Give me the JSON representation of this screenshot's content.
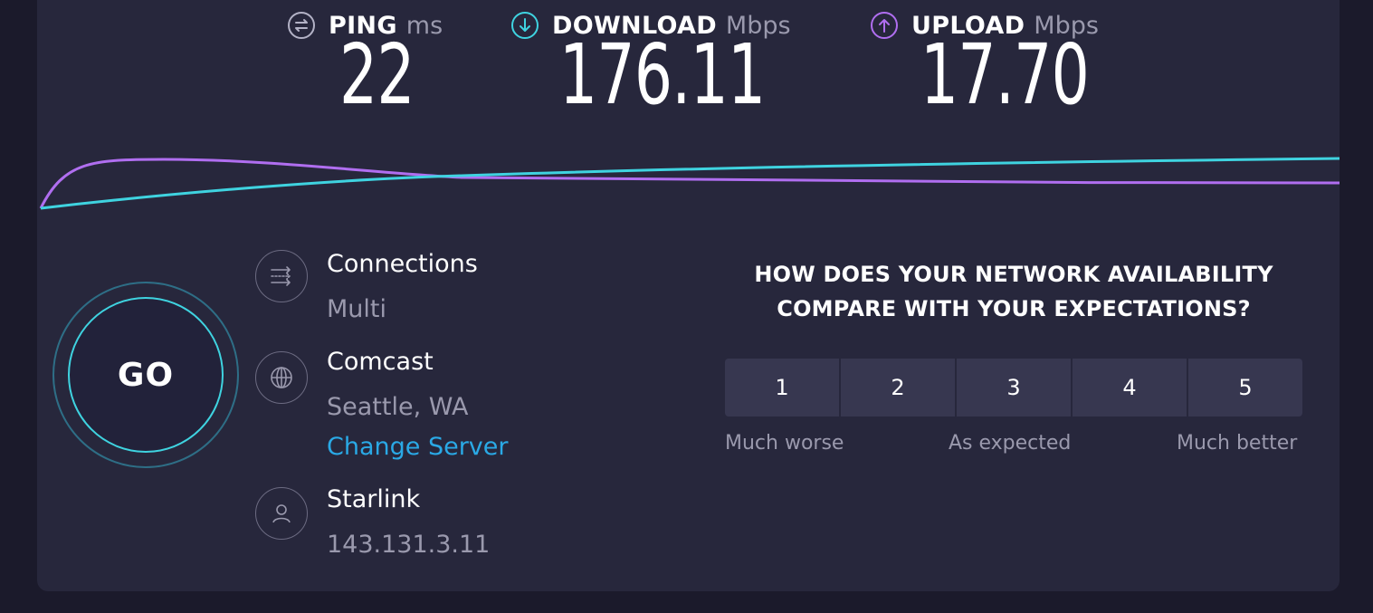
{
  "metrics": {
    "ping": {
      "label": "PING",
      "unit": "ms",
      "value": "22",
      "icon": "ping-icon",
      "color": "#b3b2c6"
    },
    "download": {
      "label": "DOWNLOAD",
      "unit": "Mbps",
      "value": "176.11",
      "icon": "download-arrow-icon",
      "color": "#3fd3e0"
    },
    "upload": {
      "label": "UPLOAD",
      "unit": "Mbps",
      "value": "17.70",
      "icon": "upload-arrow-icon",
      "color": "#b06ef0"
    }
  },
  "go": {
    "label": "GO"
  },
  "connections": {
    "title": "Connections",
    "value": "Multi",
    "icon": "connections-icon"
  },
  "server": {
    "provider": "Comcast",
    "location": "Seattle, WA",
    "change_label": "Change Server",
    "icon": "globe-icon"
  },
  "isp": {
    "name": "Starlink",
    "ip": "143.131.3.11",
    "icon": "user-icon"
  },
  "survey": {
    "question_line1": "HOW DOES YOUR NETWORK AVAILABILITY",
    "question_line2": "COMPARE WITH YOUR EXPECTATIONS?",
    "options": [
      "1",
      "2",
      "3",
      "4",
      "5"
    ],
    "labels": {
      "low": "Much worse",
      "mid": "As expected",
      "high": "Much better"
    }
  },
  "colors": {
    "accent_download": "#3fd3e0",
    "accent_upload": "#b06ef0",
    "link": "#2aa9e6",
    "panel": "#27273c",
    "background": "#1b1a2b"
  }
}
